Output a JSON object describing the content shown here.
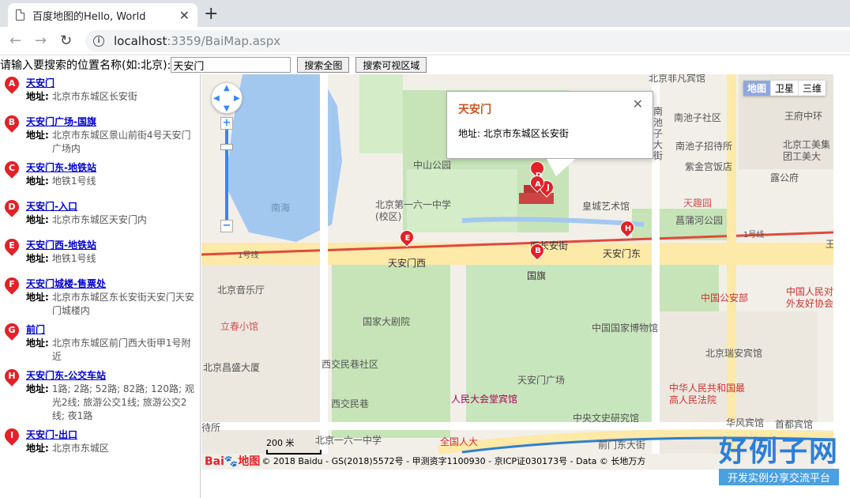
{
  "browser": {
    "tab_title": "百度地图的Hello, World",
    "url_host": "localhost",
    "url_rest": ":3359/BaiMap.aspx"
  },
  "search": {
    "label": "请输入要搜索的位置名称(如:北京):",
    "value": "天安门",
    "btn_all": "搜索全图",
    "btn_visible": "搜索可视区域"
  },
  "results": [
    {
      "letter": "A",
      "name": "天安门",
      "addr_label": "地址:",
      "addr": "北京市东城区长安街"
    },
    {
      "letter": "B",
      "name": "天安门广场-国旗",
      "addr_label": "地址:",
      "addr": "北京市东城区景山前街4号天安门广场内"
    },
    {
      "letter": "C",
      "name": "天安门东-地铁站",
      "addr_label": "地址:",
      "addr": "地铁1号线"
    },
    {
      "letter": "D",
      "name": "天安门-入口",
      "addr_label": "地址:",
      "addr": "北京市东城区天安门内"
    },
    {
      "letter": "E",
      "name": "天安门西-地铁站",
      "addr_label": "地址:",
      "addr": "地铁1号线"
    },
    {
      "letter": "F",
      "name": "天安门城楼-售票处",
      "addr_label": "地址:",
      "addr": "北京市东城区东长安街天安门天安门城楼内"
    },
    {
      "letter": "G",
      "name": "前门",
      "addr_label": "地址:",
      "addr": "北京市东城区前门西大街甲1号附近"
    },
    {
      "letter": "H",
      "name": "天安门东-公交车站",
      "addr_label": "地址:",
      "addr": "1路; 2路; 52路; 82路; 120路; 观光2线; 旅游公交1线; 旅游公交2线; 夜1路"
    },
    {
      "letter": "I",
      "name": "天安门-出口",
      "addr_label": "地址:",
      "addr": "北京市东城区"
    }
  ],
  "map": {
    "type_buttons": [
      "地图",
      "卫星",
      "三维"
    ],
    "infowindow": {
      "title": "天安门",
      "addr_label": "地址:",
      "addr": "北京市东城区长安街"
    },
    "scale": "200 米",
    "copyright": "© 2018 Baidu - GS(2018)5572号 - 甲测资字1100930 - 京ICP证030173号 - Data © 长地万方",
    "logo_text": "Bai",
    "logo_text2": "地图",
    "labels": {
      "nanhai": "南海",
      "zhongshan": "中山公园",
      "school": "北京第一六一中学(校区)",
      "xichang": "西长安街",
      "tamx": "天安门西",
      "tamd": "天安门东",
      "guoqi": "国旗",
      "line1a": "1号线",
      "line1b": "1号线",
      "music": "北京音乐厅",
      "lichun": "立春小馆",
      "theater": "国家大剧院",
      "museum": "中国国家博物馆",
      "square": "天安门广场",
      "xijiao": "西交民巷社区",
      "xijiaomx": "西交民巷",
      "renda_bg": "人民大会堂宾馆",
      "renda": "全国人大",
      "school2": "北京一六一中学",
      "zhongyang": "中央文史研究馆",
      "qianmen": "前门东大街",
      "changping": "北京昌盛大厦",
      "daitang": "待所",
      "nanchizi": "南池子社区",
      "nanchizi_zhaodai": "南池子招待所",
      "zijin": "紫金宫饭店",
      "huangcheng": "皇城艺术馆",
      "changpu": "菖蒲河公园",
      "tianqu": "天趣园",
      "gonganbu": "中国公安部",
      "ruian": "北京瑞安宾馆",
      "fayuan": "中华人民共和国最高人民法院",
      "huafeng": "华风宾馆",
      "shoudu": "首都宾馆",
      "feichang": "北京非凡宾馆",
      "wangfujing": "王府中环",
      "gongmei": "北京工美集团工美大",
      "ruirui": "露公府",
      "youxie": "中国人民对外友好协会",
      "nanchi_dajie": "南池子大街",
      "wang": "王"
    }
  },
  "watermark": {
    "main": "好例子网",
    "sub": "开发实例分享交流平台"
  }
}
